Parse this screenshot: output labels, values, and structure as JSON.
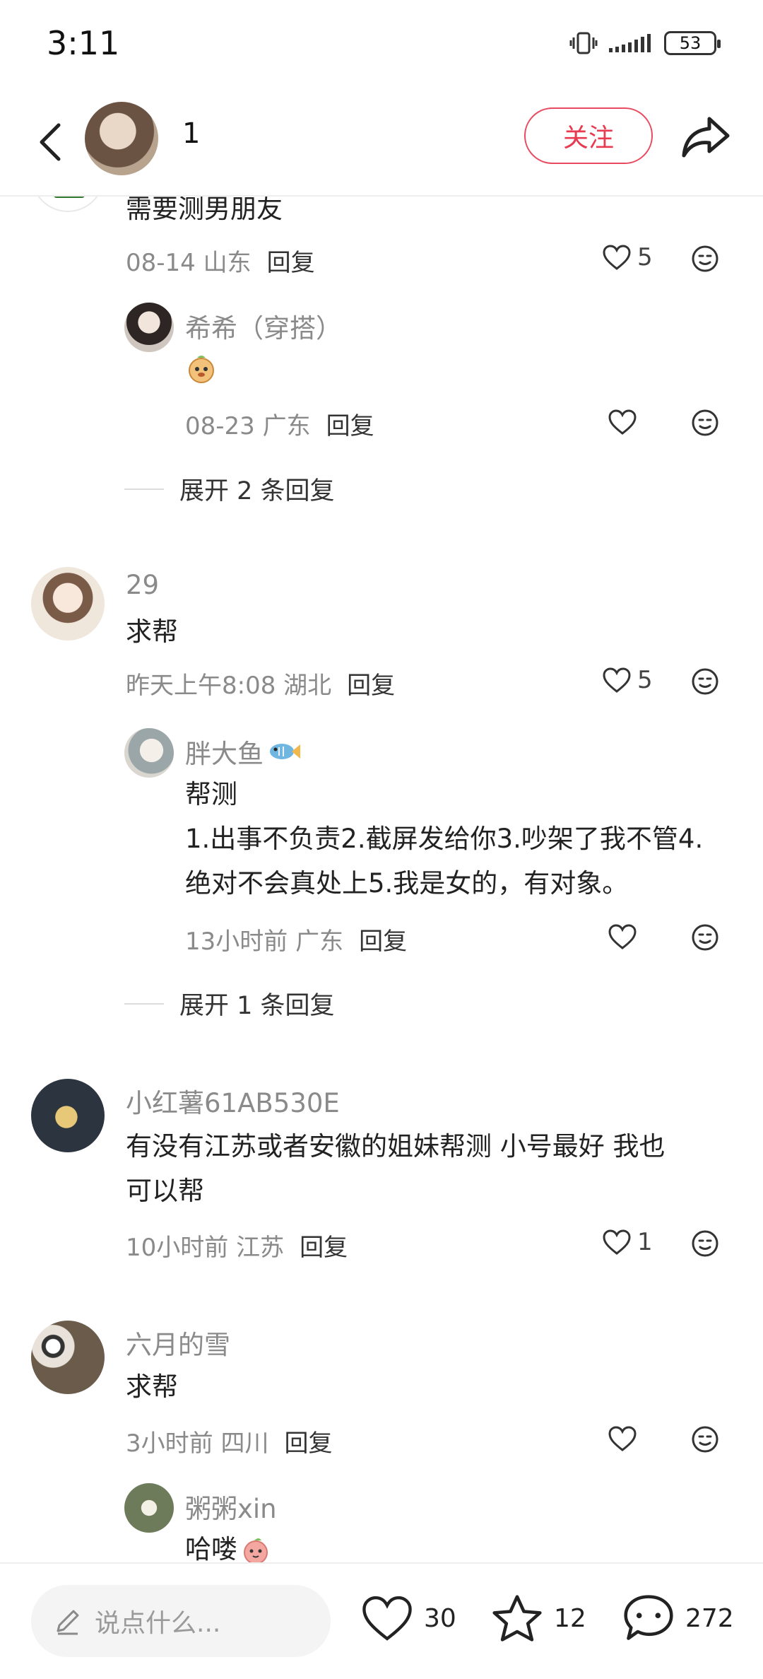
{
  "status": {
    "time": "3:11",
    "battery": "53"
  },
  "header": {
    "username": "1",
    "follow": "关注"
  },
  "comments": {
    "c0": {
      "text": "需要测男朋友",
      "date": "08-14 山东",
      "reply": "回复",
      "likes": "5"
    },
    "c0r1": {
      "name": "希希（穿搭）",
      "date": "08-23 广东",
      "reply": "回复"
    },
    "c0_expand": "展开 2 条回复",
    "c1": {
      "name": "29",
      "text": "求帮",
      "date": "昨天上午8:08 湖北",
      "reply": "回复",
      "likes": "5"
    },
    "c1r1": {
      "name": "胖大鱼",
      "line1": "帮测",
      "line2": "1.出事不负责2.截屏发给你3.吵架了我不管4.",
      "line3": "绝对不会真处上5.我是女的，有对象。",
      "date": "13小时前 广东",
      "reply": "回复"
    },
    "c1_expand": "展开 1 条回复",
    "c2": {
      "name": "小红薯61AB530E",
      "line1": "有没有江苏或者安徽的姐妹帮测 小号最好 我也",
      "line2": "可以帮",
      "date": "10小时前 江苏",
      "reply": "回复",
      "likes": "1"
    },
    "c3": {
      "name": "六月的雪",
      "text": "求帮",
      "date": "3小时前 四川",
      "reply": "回复"
    },
    "c3r1": {
      "name": "粥粥xin",
      "text": "哈喽"
    }
  },
  "bottom": {
    "placeholder": "说点什么...",
    "likes": "30",
    "stars": "12",
    "comments": "272"
  },
  "colors": {
    "accent": "#e83a50",
    "muted": "#8a8a8a"
  },
  "icons": [
    "back-arrow-icon",
    "share-icon",
    "heart-icon",
    "face-icon",
    "star-icon",
    "chat-icon",
    "pencil-icon",
    "fish-emoji",
    "sheep-emoji",
    "peach-emoji"
  ]
}
